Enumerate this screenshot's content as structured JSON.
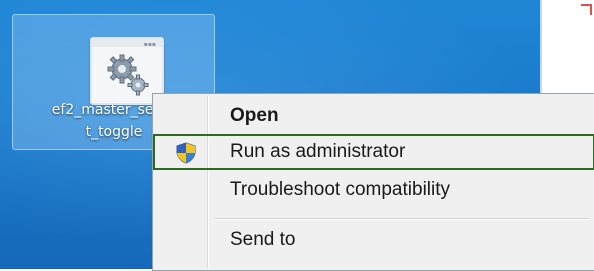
{
  "desktop": {
    "icon": {
      "name": "gear-application-icon",
      "label_line1": "ef2_master_serve",
      "label_line2": "t_toggle"
    }
  },
  "context_menu": {
    "items": [
      {
        "label": "Open",
        "bold": true
      },
      {
        "label": "Run as administrator",
        "icon": "uac-shield-icon",
        "highlighted": true
      },
      {
        "label": "Troubleshoot compatibility"
      },
      {
        "label": "Send to"
      }
    ]
  },
  "colors": {
    "desktop_blue": "#1976c8",
    "menu_background": "#f0f0f0",
    "highlight_outline": "#2e6b1f"
  }
}
